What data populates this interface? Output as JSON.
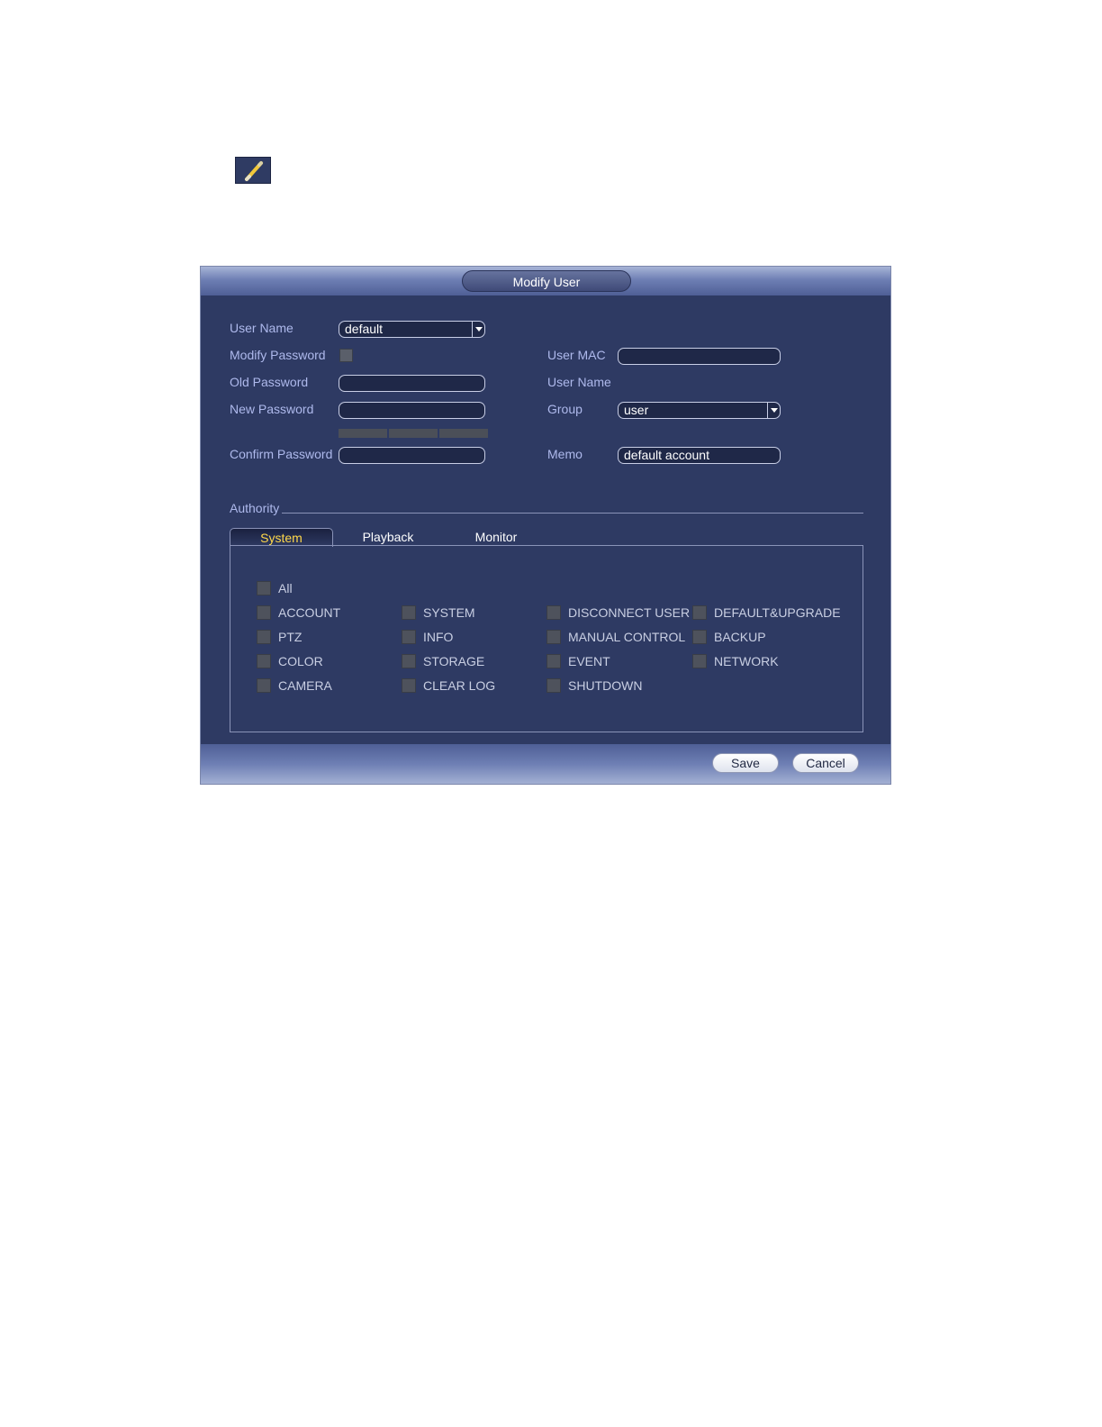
{
  "dialog": {
    "title": "Modify User"
  },
  "form": {
    "user_name_label": "User Name",
    "user_name_value": "default",
    "modify_password_label": "Modify Password",
    "old_password_label": "Old Password",
    "new_password_label": "New Password",
    "confirm_password_label": "Confirm Password",
    "user_mac_label": "User MAC",
    "user_mac_value": "",
    "right_user_name_label": "User Name",
    "group_label": "Group",
    "group_value": "user",
    "memo_label": "Memo",
    "memo_value": "default account"
  },
  "authority": {
    "label": "Authority",
    "tabs": [
      "System",
      "Playback",
      "Monitor"
    ],
    "active_tab": "System",
    "all_label": "All",
    "permissions": [
      [
        "ACCOUNT",
        "SYSTEM",
        "DISCONNECT USER",
        "DEFAULT&UPGRADE"
      ],
      [
        "PTZ",
        "INFO",
        "MANUAL CONTROL",
        "BACKUP"
      ],
      [
        "COLOR",
        "STORAGE",
        "EVENT",
        "NETWORK"
      ],
      [
        "CAMERA",
        "CLEAR LOG",
        "SHUTDOWN"
      ]
    ]
  },
  "buttons": {
    "save": "Save",
    "cancel": "Cancel"
  },
  "icons": {
    "edit": "pencil-icon",
    "dropdown": "dropdown-arrow-icon"
  },
  "colors": {
    "dialog_bg": "#2e3a63",
    "label": "#aeb9ec",
    "active_tab": "#ffd84a"
  }
}
